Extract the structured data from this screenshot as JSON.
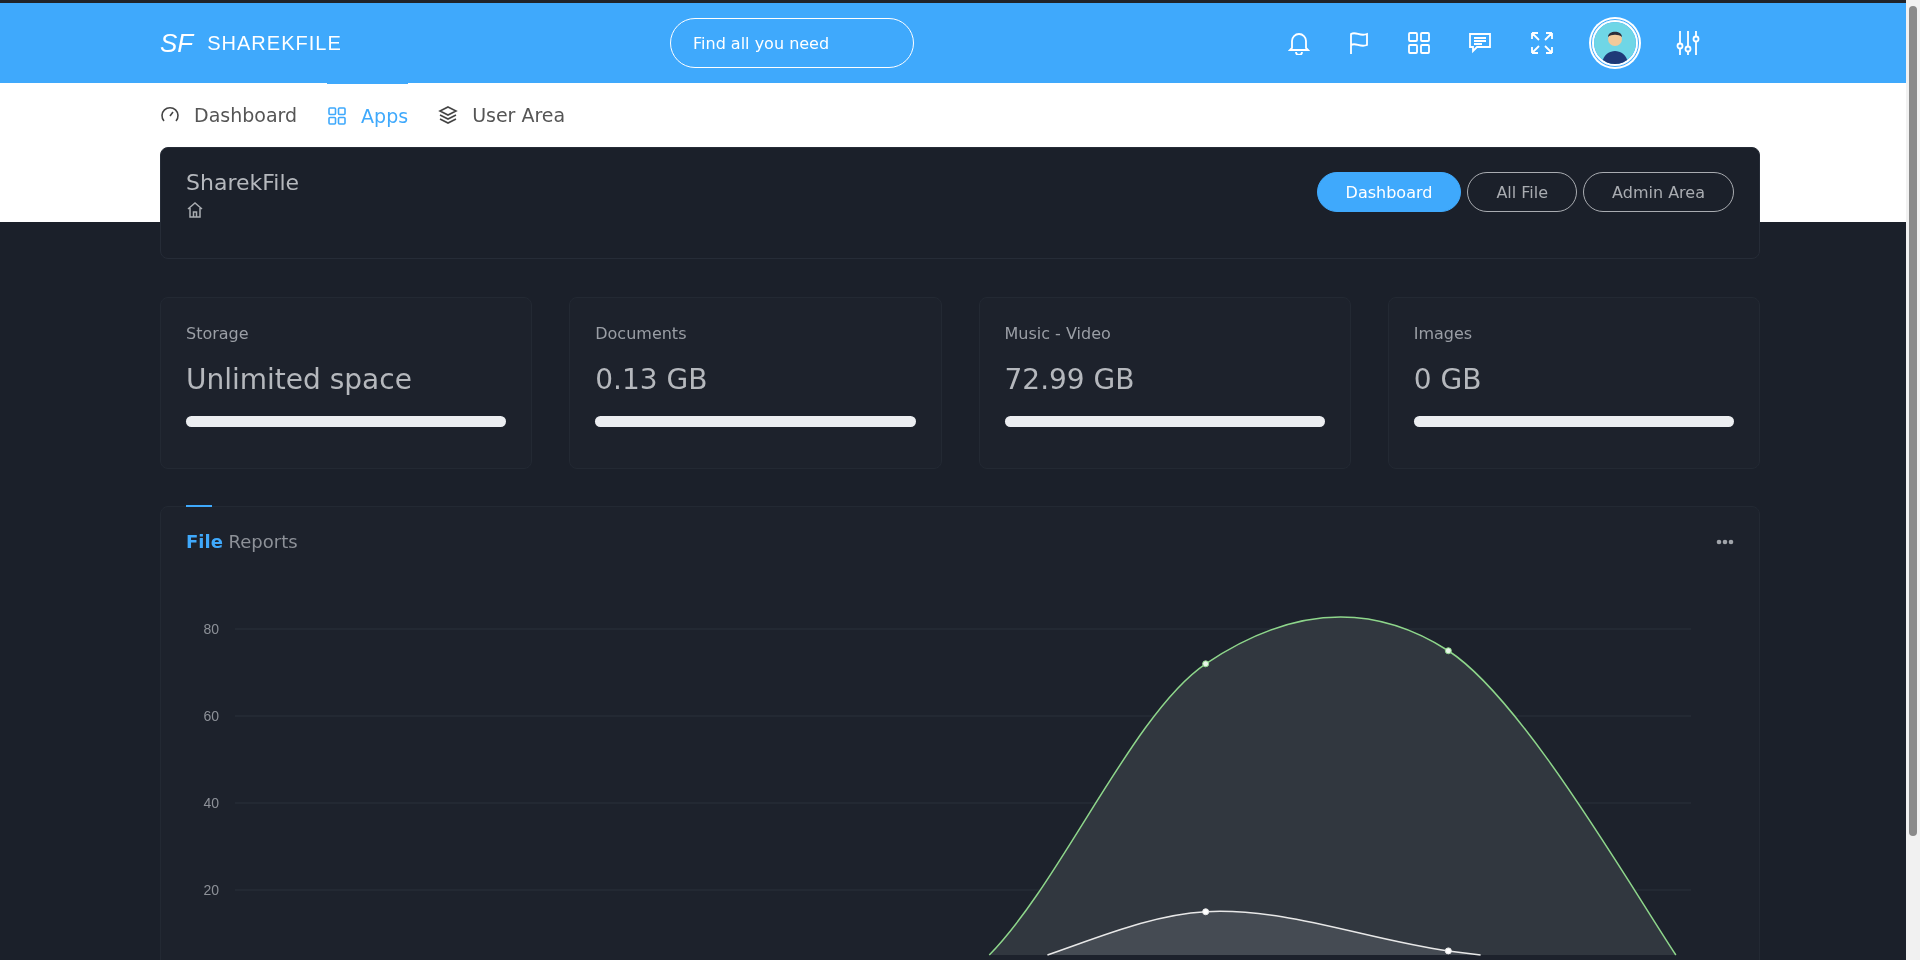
{
  "header": {
    "logo_mark": "SF",
    "brand": "SHAREKFILE",
    "search": {
      "placeholder": "Find all you need"
    }
  },
  "nav_tabs": [
    {
      "label": "Dashboard",
      "selected": false
    },
    {
      "label": "Apps",
      "selected": true
    },
    {
      "label": "User Area",
      "selected": false
    }
  ],
  "page_header": {
    "title": "SharekFile",
    "buttons": [
      {
        "label": "Dashboard",
        "selected": true
      },
      {
        "label": "All File",
        "selected": false
      },
      {
        "label": "Admin Area",
        "selected": false
      }
    ]
  },
  "stats": [
    {
      "label": "Storage",
      "value": "Unlimited space",
      "level": 1
    },
    {
      "label": "Documents",
      "value": "0.13 GB",
      "level": 1
    },
    {
      "label": "Music - Video",
      "value": "72.99 GB",
      "level": 1
    },
    {
      "label": "Images",
      "value": "0 GB",
      "level": 1
    }
  ],
  "report": {
    "title_bold": "File",
    "title_rest": "Reports",
    "y_axis_labels": [
      "80",
      "60",
      "40",
      "20"
    ]
  }
}
